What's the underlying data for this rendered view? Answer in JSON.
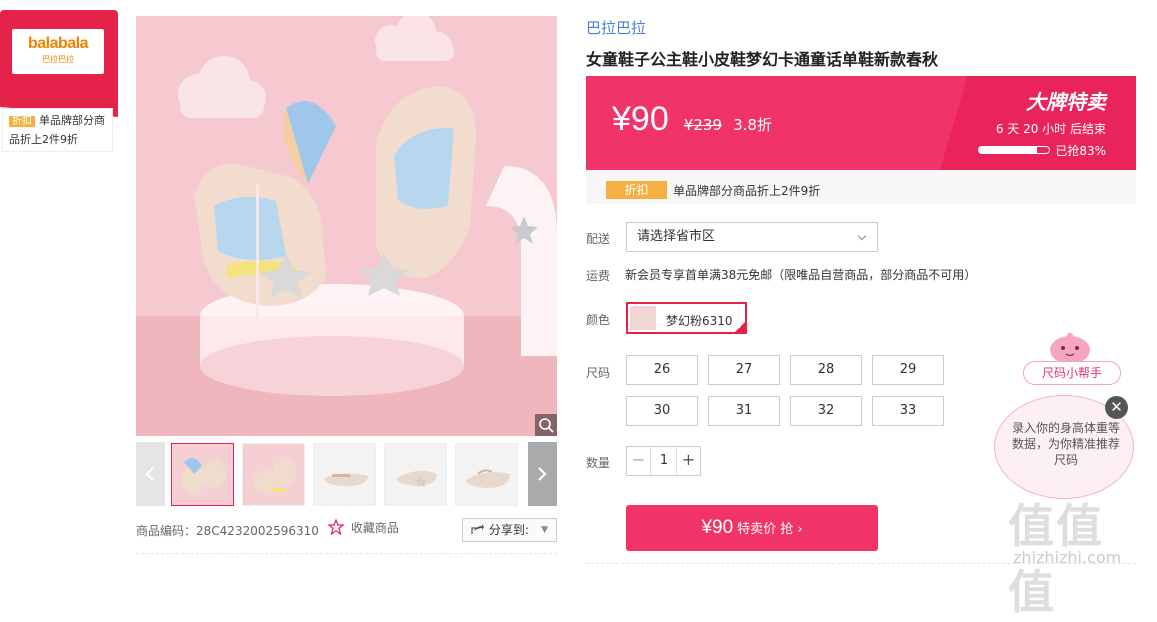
{
  "brand": {
    "logo_en": "balabala",
    "logo_cn": "巴拉巴拉",
    "tag": "折扣",
    "promo_text": "单品牌部分商品折上2件9折"
  },
  "product": {
    "code_label": "商品编码：",
    "code": "28C4232002596310",
    "favorite": "收藏商品",
    "share": "分享到:"
  },
  "info": {
    "shop_name": "巴拉巴拉",
    "title": "女童鞋子公主鞋小皮鞋梦幻卡通童话单鞋新款春秋",
    "price_now": "¥90",
    "price_old": "¥239",
    "discount": "3.8折",
    "flash_title": "大牌特卖",
    "flash_time": "6 天 20 小时 后结束",
    "flash_sold_pct": 0.83,
    "flash_sold_text": "已抢83%",
    "promo_tag": "折扣",
    "promo_text": "单品牌部分商品折上2件9折"
  },
  "options": {
    "delivery_label": "配送",
    "region_placeholder": "请选择省市区",
    "freight_label": "运费",
    "freight_text": "新会员专享首单满38元免邮（限唯品自营商品，部分商品不可用）",
    "color_label": "颜色",
    "color_value": "梦幻粉6310",
    "size_label": "尺码",
    "sizes": [
      "26",
      "27",
      "28",
      "29",
      "30",
      "31",
      "32",
      "33"
    ],
    "qty_label": "数量",
    "qty_minus": "−",
    "qty_value": "1",
    "qty_plus": "+"
  },
  "buy": {
    "price": "¥90",
    "label": "特卖价",
    "action": "抢 ›"
  },
  "helper": {
    "label": "尺码小帮手",
    "text": "录入你的身高体重等数据，为你精准推荐尺码",
    "close": "✕"
  },
  "watermark": {
    "main": "值值值",
    "sub": "zhizhizhi.com"
  },
  "colors": {
    "accent": "#f0346a",
    "brand_red": "#e4224a",
    "tag_orange": "#f6b042",
    "link_blue": "#4a7fd6"
  }
}
